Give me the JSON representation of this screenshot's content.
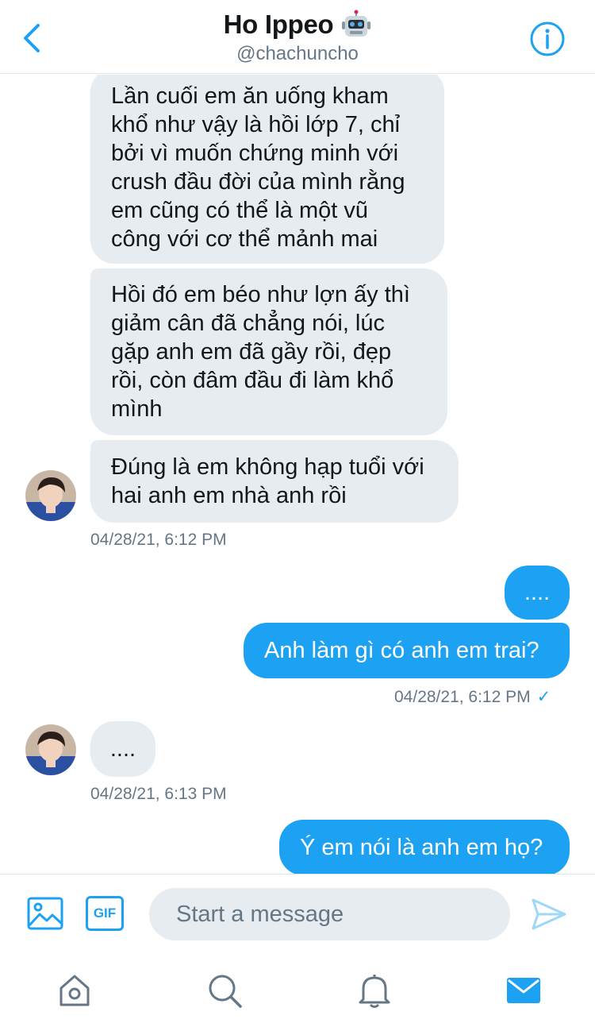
{
  "header": {
    "title": "Ho Ippeo",
    "handle": "@chachuncho"
  },
  "messages": [
    {
      "dir": "in",
      "lines": [
        "Lần cuối em ăn uống kham",
        "khổ như vậy là hồi lớp 7, chỉ",
        "bởi vì muốn chứng minh với",
        "crush đầu đời của mình rằng",
        "em cũng có thể là một vũ",
        "công với cơ thể mảnh mai"
      ]
    },
    {
      "dir": "in",
      "lines": [
        "Hồi đó em béo như lợn ấy thì",
        "giảm cân đã chẳng nói, lúc",
        "gặp anh em đã gầy rồi, đẹp",
        "rồi, còn đâm đầu đi làm khổ",
        "mình"
      ]
    },
    {
      "dir": "in",
      "lines": [
        "Đúng là em không hạp tuổi với",
        "hai anh em nhà anh rồi"
      ]
    },
    {
      "dir": "out",
      "lines": [
        "...."
      ]
    },
    {
      "dir": "out",
      "lines": [
        "Anh làm gì có anh em trai?"
      ]
    },
    {
      "dir": "in",
      "lines": [
        "...."
      ]
    },
    {
      "dir": "out",
      "lines": [
        "Ý em nói là anh em họ?"
      ]
    }
  ],
  "timestamps": [
    "04/28/21, 6:12 PM",
    "04/28/21, 6:12 PM",
    "04/28/21, 6:13 PM"
  ],
  "read_mark": "✓",
  "composer": {
    "gif_label": "GIF",
    "placeholder": "Start a message"
  },
  "colors": {
    "accent": "#1da1f2",
    "incoming_bubble": "#e6ecf0",
    "muted_text": "#657786"
  },
  "tabs": [
    "home-icon",
    "search-icon",
    "notifications-icon",
    "messages-icon"
  ]
}
